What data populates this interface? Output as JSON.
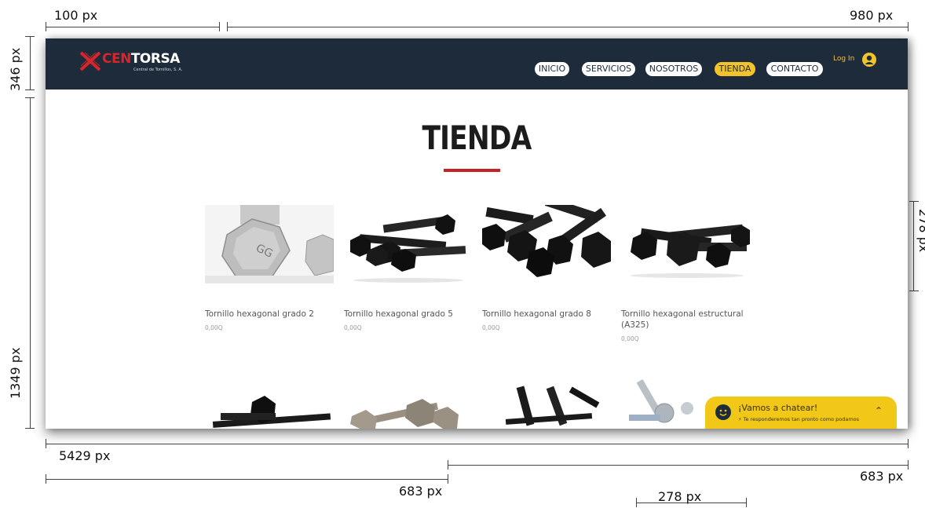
{
  "annotations": {
    "top_left_width": "100 px",
    "top_right_width": "980 px",
    "left_header_height": "346 px",
    "left_body_height": "1349 px",
    "right_image_height": "278 px",
    "total_width": "5429 px",
    "half_left_width": "683 px",
    "half_right_width": "683 px",
    "product_width": "278 px"
  },
  "site": {
    "logo": {
      "brand_red": "CEN",
      "brand_white": "TORSA",
      "tagline": "Central de Tornillos, S. A."
    },
    "nav": {
      "items": [
        {
          "label": "INICIO",
          "active": false
        },
        {
          "label": "SERVICIOS",
          "active": false
        },
        {
          "label": "NOSOTROS",
          "active": false
        },
        {
          "label": "TIENDA",
          "active": true
        },
        {
          "label": "CONTACTO",
          "active": false
        }
      ],
      "login_label": "Log In",
      "user_icon": "user-avatar-icon"
    },
    "page_title": "TIENDA",
    "products": [
      {
        "name": "Tornillo hexagonal grado 2",
        "price": "0,00Q",
        "image": "silver-hex-bolt-head"
      },
      {
        "name": "Tornillo hexagonal grado 5",
        "price": "0,00Q",
        "image": "black-hex-bolts"
      },
      {
        "name": "Tornillo hexagonal grado 8",
        "price": "0,00Q",
        "image": "black-hex-bolts-pile"
      },
      {
        "name": "Tornillo hexagonal estructural (A325)",
        "price": "0,00Q",
        "image": "black-structural-bolts"
      }
    ],
    "chat": {
      "title": "¡Vamos a chatear!",
      "subtitle": "Te responderemos tan pronto como podamos",
      "icon": "smiley-chat-icon"
    }
  },
  "colors": {
    "header_bg": "#1e2b3b",
    "accent_yellow": "#f2c32b",
    "brand_red": "#d6262b",
    "underline_red": "#c82027"
  }
}
